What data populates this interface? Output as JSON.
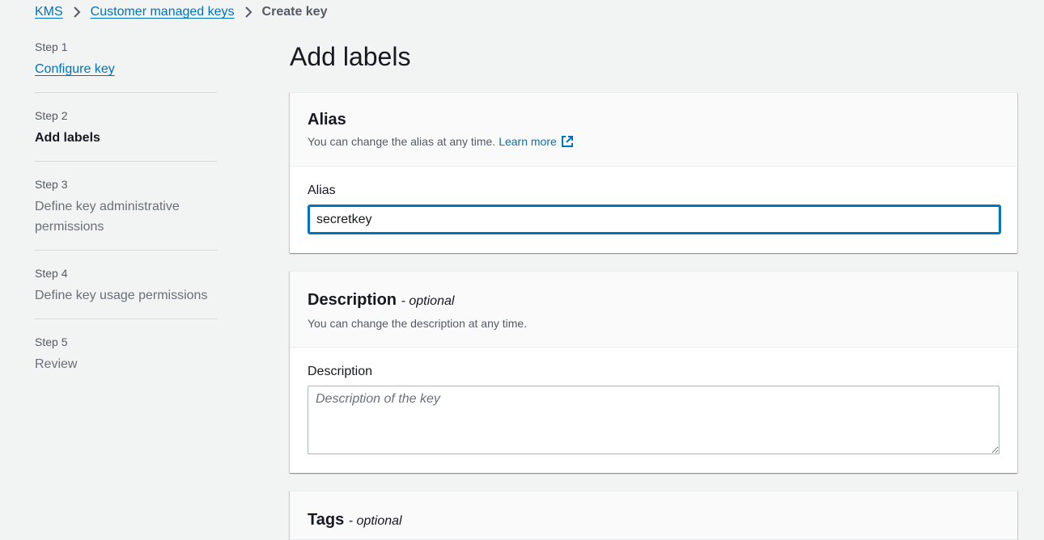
{
  "breadcrumb": {
    "items": [
      "KMS",
      "Customer managed keys"
    ],
    "current": "Create key"
  },
  "steps": [
    {
      "num": "Step 1",
      "title": "Configure key",
      "state": "link"
    },
    {
      "num": "Step 2",
      "title": "Add labels",
      "state": "active"
    },
    {
      "num": "Step 3",
      "title": "Define key administrative permissions",
      "state": "disabled"
    },
    {
      "num": "Step 4",
      "title": "Define key usage permissions",
      "state": "disabled"
    },
    {
      "num": "Step 5",
      "title": "Review",
      "state": "disabled"
    }
  ],
  "page": {
    "title": "Add labels"
  },
  "alias_panel": {
    "title": "Alias",
    "description": "You can change the alias at any time.",
    "learn_more": "Learn more",
    "field_label": "Alias",
    "field_value": "secretkey"
  },
  "description_panel": {
    "title": "Description",
    "optional": "- optional",
    "description": "You can change the description at any time.",
    "field_label": "Description",
    "placeholder": "Description of the key"
  },
  "tags_panel": {
    "title": "Tags",
    "optional": "- optional"
  },
  "colors": {
    "link": "#0073bb",
    "background": "#f2f3f3",
    "focus_border": "#0073bb"
  },
  "icons": [
    "chevron-right-icon",
    "external-link-icon",
    "resize-handle-icon"
  ]
}
